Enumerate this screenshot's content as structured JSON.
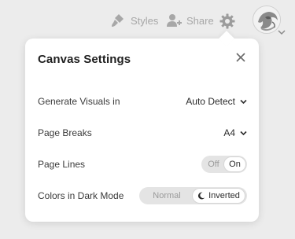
{
  "toolbar": {
    "styles_label": "Styles",
    "share_label": "Share",
    "icons": [
      "brush-icon",
      "add-user-icon",
      "gear-icon",
      "avatar",
      "chevron-down-icon"
    ]
  },
  "panel": {
    "title": "Canvas Settings",
    "settings": {
      "generate_visuals": {
        "label": "Generate Visuals in",
        "value": "Auto Detect"
      },
      "page_breaks": {
        "label": "Page Breaks",
        "value": "A4"
      },
      "page_lines": {
        "label": "Page Lines",
        "options": [
          "Off",
          "On"
        ],
        "selected": "On"
      },
      "dark_mode": {
        "label": "Colors in Dark Mode",
        "options": [
          "Normal",
          "Inverted"
        ],
        "selected": "Inverted"
      }
    }
  },
  "colors": {
    "background": "#ececec",
    "panel": "#ffffff",
    "toolbar_icon": "#a7a7a7",
    "segment_track": "#e4e4e4"
  }
}
